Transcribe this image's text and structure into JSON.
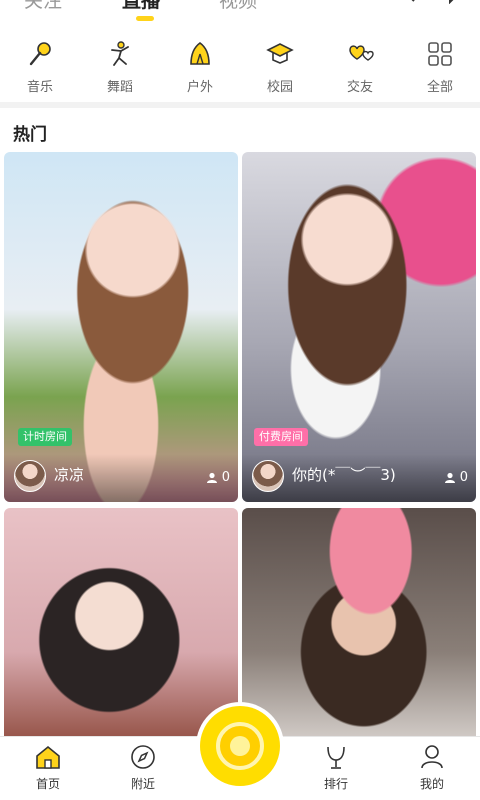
{
  "top_tabs": [
    {
      "label": "关注",
      "active": false
    },
    {
      "label": "直播",
      "active": true
    },
    {
      "label": "视频",
      "active": false
    }
  ],
  "top_icons": [
    "search-icon",
    "message-icon"
  ],
  "categories": [
    {
      "label": "音乐",
      "icon": "microphone-icon"
    },
    {
      "label": "舞蹈",
      "icon": "dancer-icon"
    },
    {
      "label": "户外",
      "icon": "tent-icon"
    },
    {
      "label": "校园",
      "icon": "graduation-cap-icon"
    },
    {
      "label": "交友",
      "icon": "hearts-icon"
    },
    {
      "label": "全部",
      "icon": "grid-icon"
    }
  ],
  "section_title": "热门",
  "cards": [
    {
      "badge": "计时房间",
      "badge_color": "#33c26a",
      "name": "凉凉",
      "viewers": "0"
    },
    {
      "badge": "付费房间",
      "badge_color": "#ff6fa8",
      "name": "你的(*￣︶￣3)",
      "viewers": "0"
    },
    {
      "badge": "",
      "name": "",
      "viewers": ""
    },
    {
      "badge": "",
      "name": "",
      "viewers": ""
    }
  ],
  "bottom_nav": [
    {
      "label": "首页",
      "icon": "home-icon",
      "active": true
    },
    {
      "label": "附近",
      "icon": "compass-icon",
      "active": false
    },
    {
      "label": "排行",
      "icon": "trophy-icon",
      "active": false
    },
    {
      "label": "我的",
      "icon": "user-icon",
      "active": false
    }
  ],
  "colors": {
    "accent": "#ffd31a",
    "text": "#222222",
    "muted": "#666666"
  }
}
